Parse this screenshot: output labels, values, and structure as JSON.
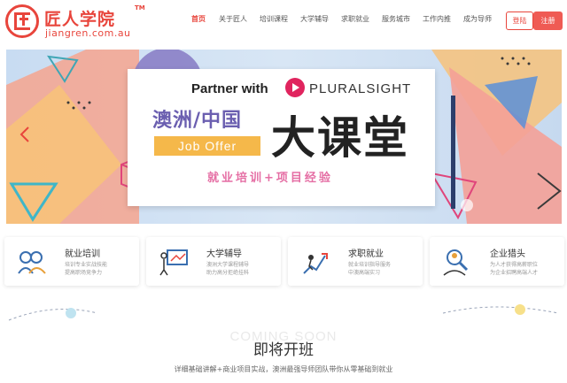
{
  "brand": {
    "title": "匠人学院",
    "tm": "TM",
    "domain": "jiangren.com.au",
    "accent": "#e8453c"
  },
  "nav": {
    "items": [
      {
        "label": "首页",
        "active": true
      },
      {
        "label": "关于匠人",
        "active": false
      },
      {
        "label": "培训课程",
        "active": false
      },
      {
        "label": "大学辅导",
        "active": false
      },
      {
        "label": "求职就业",
        "active": false
      },
      {
        "label": "服务城市",
        "active": false
      },
      {
        "label": "工作内推",
        "active": false
      },
      {
        "label": "成为导师",
        "active": false
      }
    ],
    "login_label": "登陆",
    "register_label": "注册"
  },
  "banner": {
    "partner_text": "Partner with",
    "partner_brand": "PLURALSIGHT",
    "title_left": "澳洲/中国",
    "badge": "Job Offer",
    "title_big": "大课堂",
    "subtitle": "就业培训+项目经验",
    "prev_icon": "chevron-left-icon"
  },
  "features": [
    {
      "title": "就业培训",
      "desc": "培训专业实战技能\n提高职场竞争力",
      "icon": "people-icon"
    },
    {
      "title": "大学辅导",
      "desc": "澳洲大学课程辅导\n助力高分拒绝挂科",
      "icon": "presentation-icon"
    },
    {
      "title": "求职就业",
      "desc": "就业培训指导服务\n中澳高端实习",
      "icon": "climbing-icon"
    },
    {
      "title": "企业猎头",
      "desc": "为人才获得高薪职位\n为企业招聘高端人才",
      "icon": "headhunter-icon"
    }
  ],
  "soon": {
    "coming": "COMING SOON",
    "title": "即将开班",
    "desc": "详细基础讲解+商业项目实战，澳洲最强导师团队带你从零基础到就业"
  }
}
